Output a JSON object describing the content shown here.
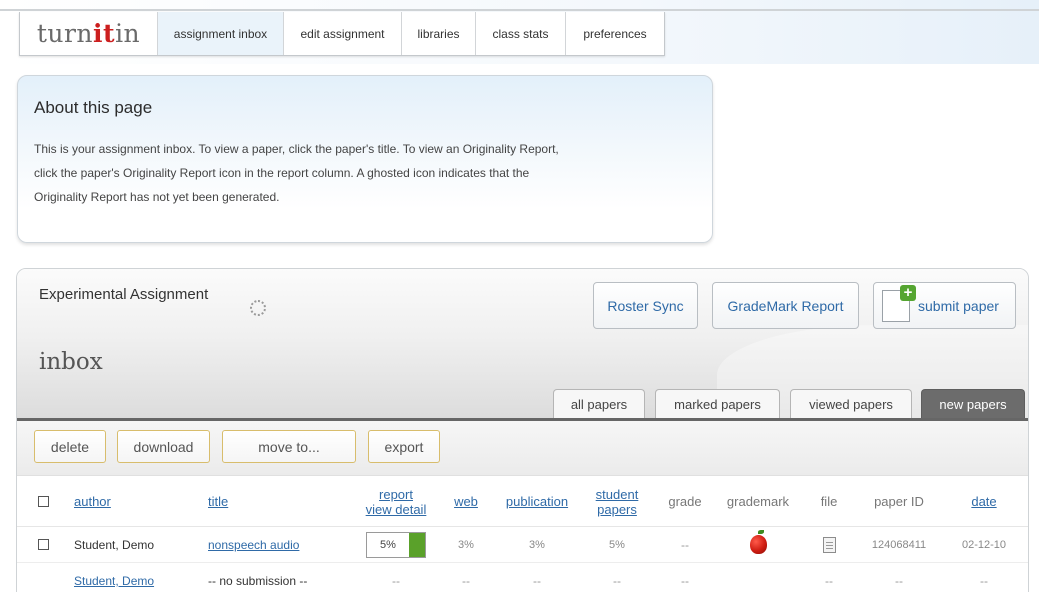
{
  "nav": {
    "logo": "turnitin",
    "tabs": [
      "assignment inbox",
      "edit assignment",
      "libraries",
      "class stats",
      "preferences"
    ]
  },
  "about": {
    "title": "About this page",
    "line1": "This is your assignment inbox. To view a paper, click the paper's title. To view an Originality Report,",
    "line2": "click the paper's Originality Report icon in the report column. A ghosted icon indicates that the",
    "line3": "Originality Report has not yet been generated."
  },
  "assignment": {
    "title": "Experimental Assignment",
    "inbox_label": "inbox",
    "buttons": {
      "roster": "Roster Sync",
      "grademark": "GradeMark Report",
      "submit": "submit paper"
    },
    "filter_tabs": [
      "all papers",
      "marked papers",
      "viewed papers",
      "new papers"
    ],
    "active_filter": "new papers"
  },
  "toolbar": {
    "delete": "delete",
    "download": "download",
    "move": "move to...",
    "export": "export"
  },
  "table": {
    "headers": {
      "author": "author",
      "title": "title",
      "report_line1": "report",
      "report_line2": "view detail",
      "web": "web",
      "publication": "publication",
      "student_line1": "student",
      "student_line2": "papers",
      "grade": "grade",
      "grademark": "grademark",
      "file": "file",
      "paper_id": "paper ID",
      "date": "date"
    },
    "rows": [
      {
        "author": "Student, Demo",
        "title": "nonspeech audio",
        "report": "5%",
        "web": "3%",
        "publication": "3%",
        "student_papers": "5%",
        "grade": "--",
        "paper_id": "124068411",
        "date": "02-12-10"
      },
      {
        "author": "Student, Demo",
        "title": "-- no submission --",
        "report": "--",
        "web": "--",
        "publication": "--",
        "student_papers": "--",
        "grade": "--",
        "file": "--",
        "paper_id": "--",
        "date": "--"
      }
    ]
  },
  "colors": {
    "link": "#2f6aa7",
    "logo_accent": "#cc1f1f",
    "report_bar": "#5aa12a",
    "active_tab": "#6c6c6c"
  }
}
